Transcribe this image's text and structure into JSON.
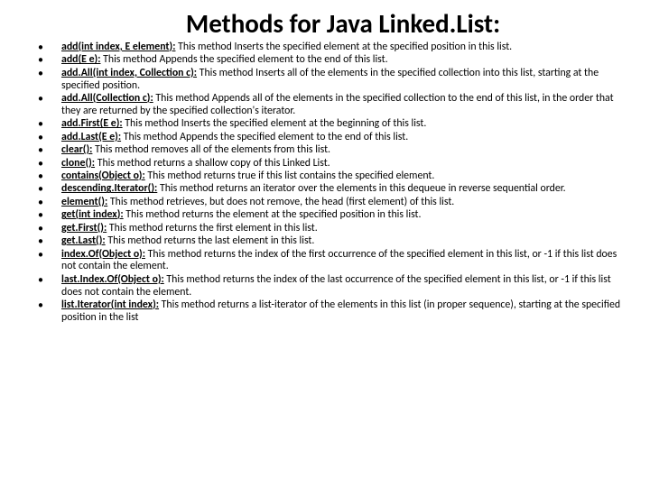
{
  "title": "Methods for Java Linked.List:",
  "methods": [
    {
      "name": "add(int index, E element):",
      "desc": " This method Inserts the specified element at the specified position in this list."
    },
    {
      "name": "add(E e):",
      "desc": " This method Appends the specified element to the end of this list."
    },
    {
      "name": "add.All(int index, Collection c):",
      "desc": " This method Inserts all of the elements in the specified collection into this list, starting at the specified position."
    },
    {
      "name": "add.All(Collection c):",
      "desc": " This method Appends all of the elements in the specified collection to the end of this list, in the order that they are returned by the specified collection's iterator."
    },
    {
      "name": "add.First(E e):",
      "desc": " This method Inserts the specified element at the beginning of this list."
    },
    {
      "name": "add.Last(E e):",
      "desc": " This method Appends the specified element to the end of this list."
    },
    {
      "name": "clear():",
      "desc": " This method removes all of the elements from this list."
    },
    {
      "name": "clone():",
      "desc": " This method returns a shallow copy of this Linked List."
    },
    {
      "name": "contains(Object o):",
      "desc": " This method returns true if this list contains the specified element."
    },
    {
      "name": "descending.Iterator():",
      "desc": " This method returns an iterator over the elements in this dequeue in reverse sequential order."
    },
    {
      "name": "element():",
      "desc": " This method retrieves, but does not remove, the head (first element) of this list."
    },
    {
      "name": "get(int index):",
      "desc": " This method returns the element at the specified position in this list."
    },
    {
      "name": "get.First():",
      "desc": " This method returns the first element in this list."
    },
    {
      "name": "get.Last():",
      "desc": " This method returns the last element in this list."
    },
    {
      "name": "index.Of(Object o):",
      "desc": " This method returns the index of the first occurrence of the specified element in this list, or -1 if this list does not contain the element."
    },
    {
      "name": "last.Index.Of(Object o):",
      "desc": " This method returns the index of the last occurrence of the specified element in this list, or -1 if this list does not contain the element."
    },
    {
      "name": "list.Iterator(int index):",
      "desc": " This method returns a list-iterator of the elements in this list (in proper sequence), starting at the specified position in the list"
    }
  ]
}
